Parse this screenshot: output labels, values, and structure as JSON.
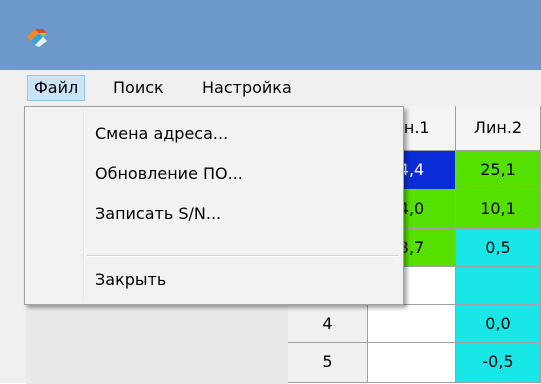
{
  "window": {
    "app_icon": "app-logo-icon"
  },
  "menubar": {
    "items": [
      "Файл",
      "Поиск",
      "Настройка"
    ],
    "active_index": 0
  },
  "file_menu": {
    "items": [
      "Смена адреса...",
      "Обновление ПО...",
      "Записать S/N...",
      "Закрыть"
    ]
  },
  "table": {
    "headers": [
      "нн.1",
      "Лин.2"
    ],
    "rows": [
      {
        "num": "",
        "col1": "4,4",
        "col2": "25,1"
      },
      {
        "num": "",
        "col1": "4,0",
        "col2": "10,1"
      },
      {
        "num": "",
        "col1": "3,7",
        "col2": "0,5"
      },
      {
        "num": "4",
        "col1": "",
        "col2": "0,0"
      },
      {
        "num": "5",
        "col1": "",
        "col2": "-0,5"
      }
    ]
  },
  "colors": {
    "titlebar": "#6e9ac9",
    "menu_highlight": "#cce4f7",
    "cell_blue": "#0a2cd8",
    "cell_green": "#55e000",
    "cell_cyan": "#19e6e6"
  }
}
